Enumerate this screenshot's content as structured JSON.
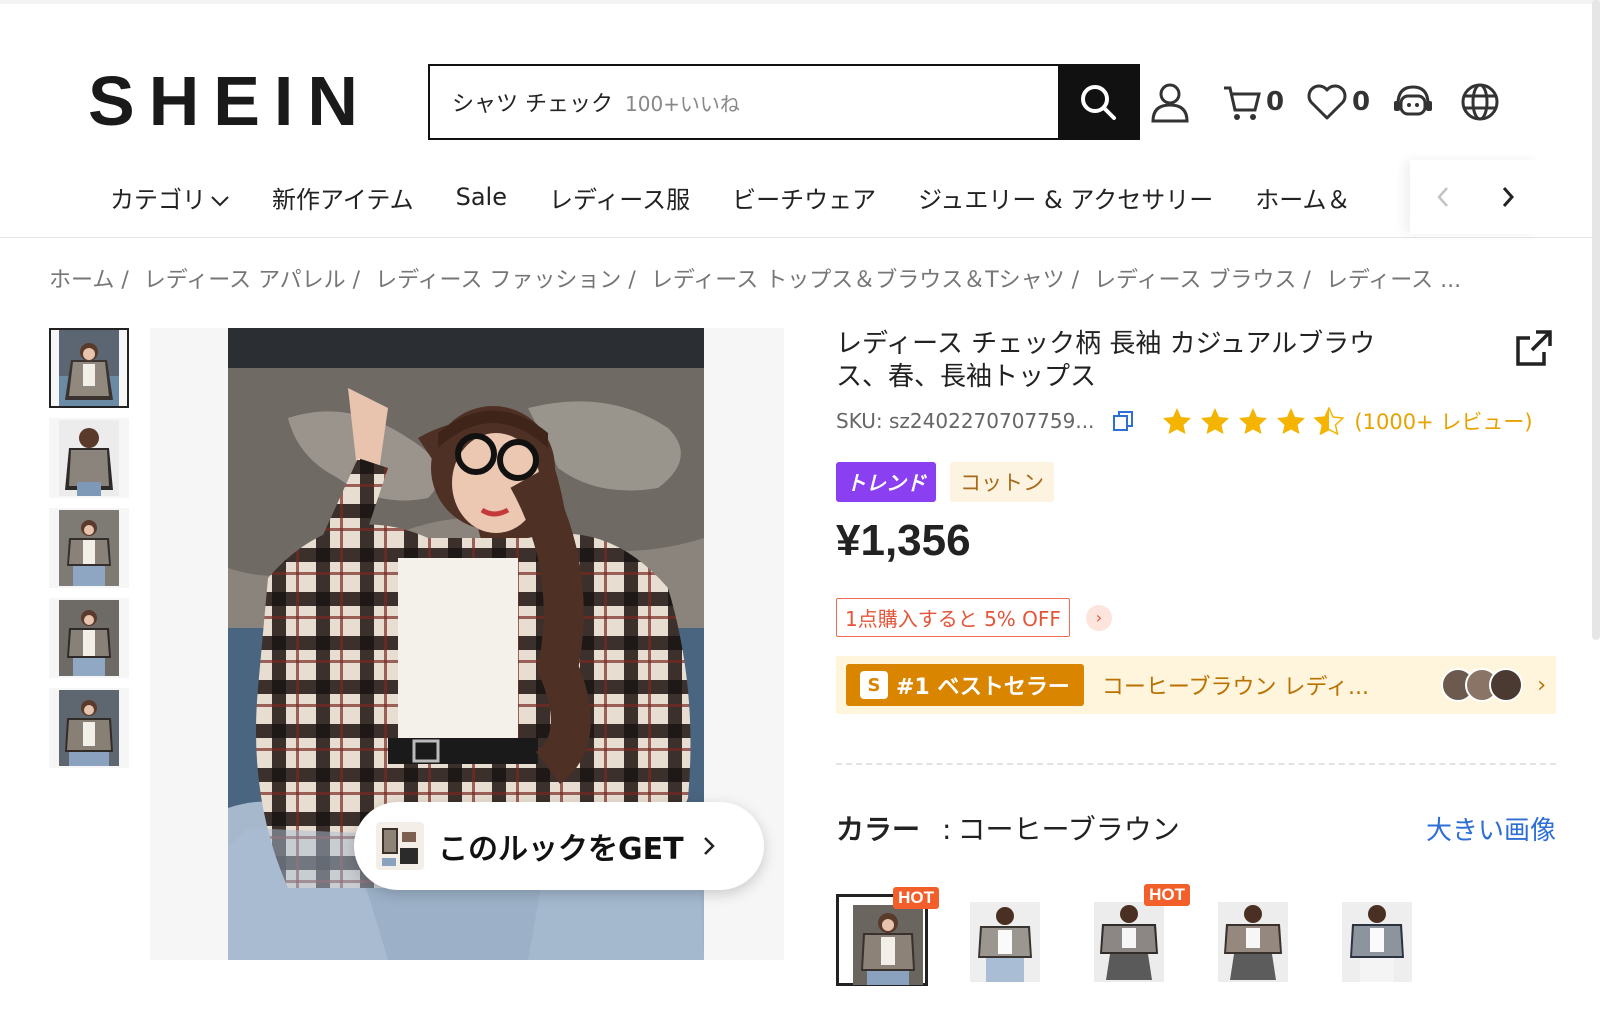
{
  "header": {
    "logo": "SHEIN",
    "search": {
      "query": "シャツ チェック",
      "hint": "100+いいね"
    },
    "cart_count": "0",
    "wishlist_count": "0"
  },
  "nav": {
    "items": [
      "カテゴリ",
      "新作アイテム",
      "Sale",
      "レディース服",
      "ビーチウェア",
      "ジュエリー & アクセサリー",
      "ホーム＆"
    ]
  },
  "breadcrumb": [
    "ホーム /",
    "レディース アパレル /",
    "レディース ファッション /",
    "レディース トップス＆ブラウス＆Tシャツ /",
    "レディース ブラウス /",
    "レディース ..."
  ],
  "product": {
    "title": "レディース チェック柄 長袖 カジュアルブラウス、春、長袖トップス",
    "sku": "SKU: sz2402270707759...",
    "rating": 4.5,
    "reviews": "(1000+ レビュー)",
    "tags": {
      "trend": "トレンド",
      "material": "コットン"
    },
    "price": "¥1,356",
    "promo": "1点購入すると 5% OFF",
    "bestseller": {
      "badge": "#1 ベストセラー",
      "text": "コーヒーブラウン レディ..."
    },
    "get_look": "このルックをGET",
    "color": {
      "label": "カラー",
      "sep": ":",
      "value": "コーヒーブラウン",
      "big_image": "大きい画像"
    },
    "swatch_badge": "HOT"
  },
  "colors": {
    "accent_trend": "#8a3ff0",
    "price_promo": "#e5553a",
    "link": "#2d6fd4",
    "bestseller": "#d98500"
  }
}
